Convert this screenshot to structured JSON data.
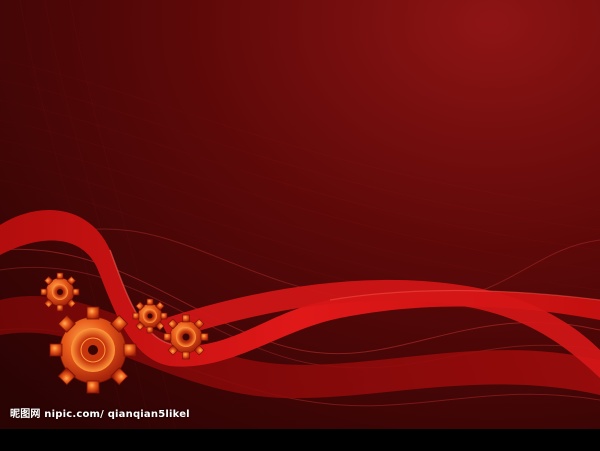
{
  "watermark": {
    "text": "昵图网 nipic.com/ qianqian5likel"
  },
  "colors": {
    "background_light": "#8a1010",
    "background_dark": "#2a0303",
    "ribbon": "#d41414",
    "gear": "#e24a17",
    "footer": "#000000"
  },
  "icons": [
    "gear-icon",
    "gear-icon",
    "gear-icon",
    "gear-icon"
  ]
}
